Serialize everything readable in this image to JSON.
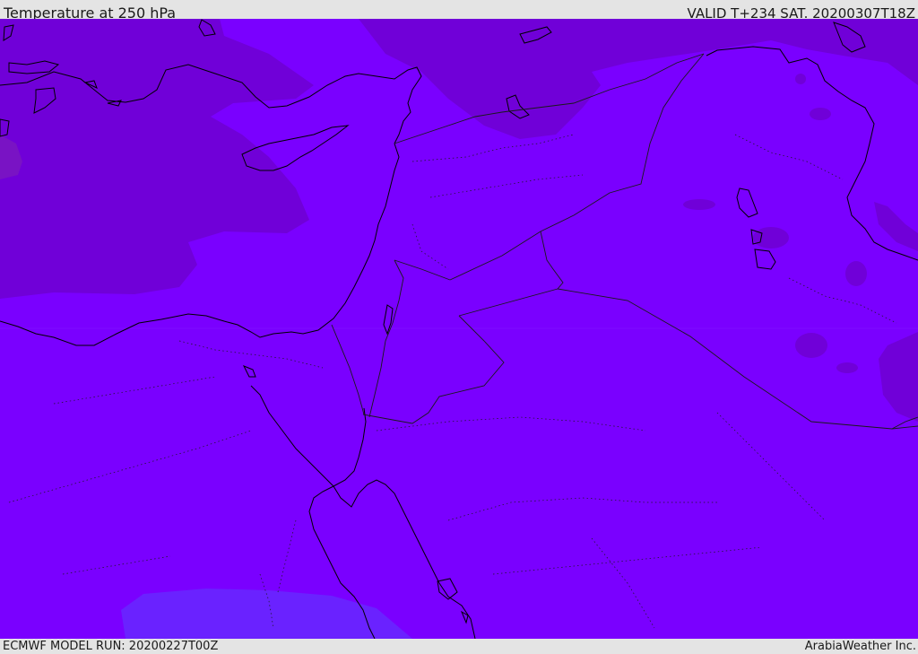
{
  "header": {
    "title": "Temperature at 250 hPa",
    "valid": "VALID T+234 SAT. 20200307T18Z"
  },
  "footer": {
    "model_run": "ECMWF MODEL RUN: 20200227T00Z",
    "credit": "ArabiaWeather Inc."
  },
  "colors": {
    "field_main": "#7a00ff",
    "field_cool_region": "#7000d8",
    "field_warm_region": "#6a22ff",
    "coastline": "#000000",
    "border": "#1a1a1a",
    "background": "#e4e4e4"
  }
}
